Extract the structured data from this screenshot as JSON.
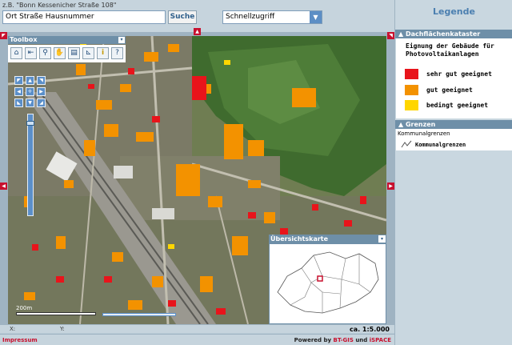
{
  "header": {
    "hint": "z.B. \"Bonn Kessenicher Straße 108\"",
    "search_value": "Ort Straße Hausnummer",
    "search_button": "Suche",
    "quick_access": "Schnellzugriff"
  },
  "toolbox": {
    "title": "Toolbox",
    "tools": [
      "home-icon",
      "back-icon",
      "zoom-icon",
      "pan-icon",
      "print-icon",
      "measure-icon",
      "info-icon",
      "help-icon"
    ]
  },
  "overview": {
    "title": "Übersichtskarte"
  },
  "map": {
    "scale_label": "200m"
  },
  "status": {
    "x_label": "X:",
    "y_label": "Y:",
    "scale": "ca. 1:5.000"
  },
  "footer": {
    "impressum": "Impressum",
    "powered_prefix": "Powered by",
    "powered_a": "BT-GIS",
    "powered_and": "und",
    "powered_b": "iSPACE"
  },
  "legend": {
    "title": "Legende",
    "section1": {
      "title": "Dachflächenkataster",
      "heading": "Eignung der Gebäude für Photovoltaikanlagen",
      "items": [
        {
          "label": "sehr gut geeignet",
          "color": "#e8141b"
        },
        {
          "label": "gut geeignet",
          "color": "#f39200"
        },
        {
          "label": "bedingt geeignet",
          "color": "#ffd600"
        }
      ]
    },
    "section2": {
      "title": "Grenzen",
      "group": "Kommunalgrenzen",
      "item": "Kommunalgrenzen"
    }
  }
}
